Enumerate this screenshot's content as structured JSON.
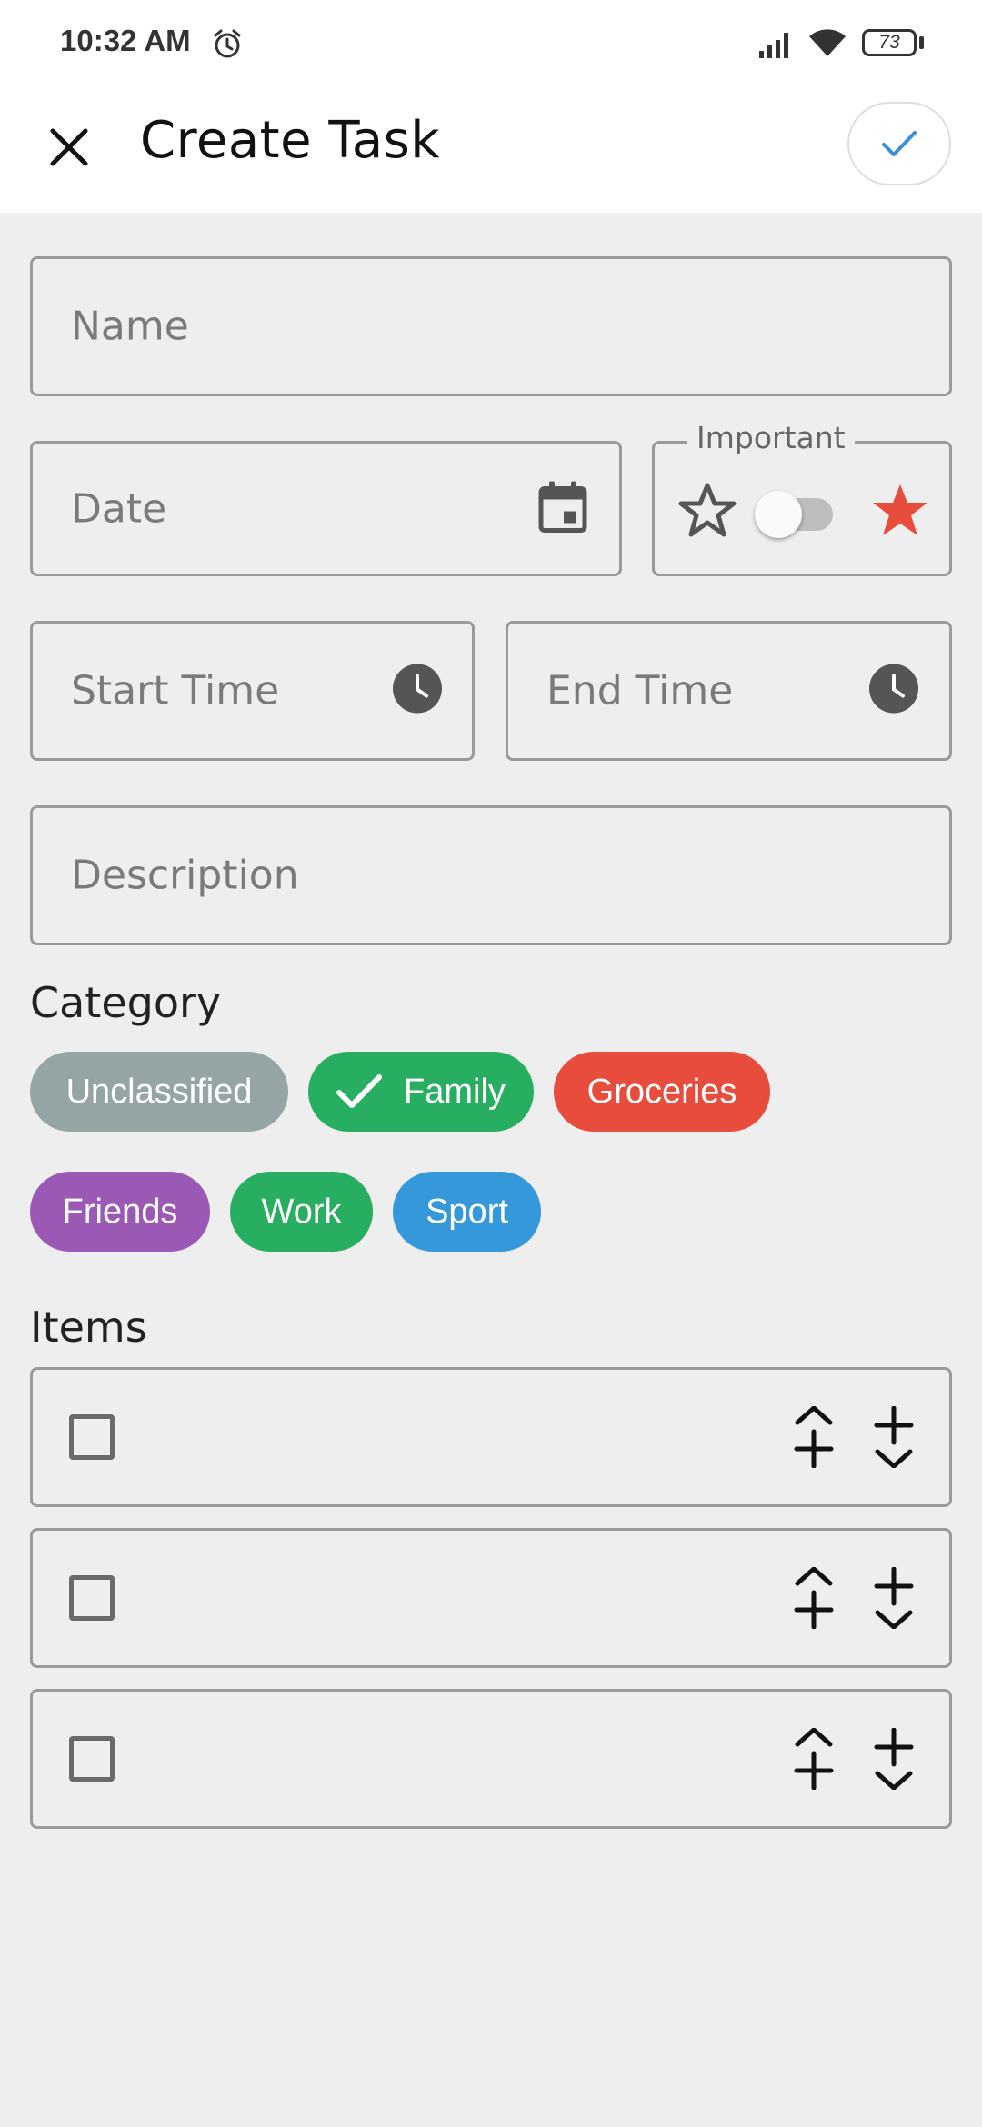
{
  "status_bar": {
    "time": "10:32 AM",
    "battery": "73"
  },
  "app_bar": {
    "title": "Create Task"
  },
  "form": {
    "name_placeholder": "Name",
    "date_placeholder": "Date",
    "important_label": "Important",
    "important_on": false,
    "start_time_placeholder": "Start Time",
    "end_time_placeholder": "End Time",
    "description_placeholder": "Description"
  },
  "category": {
    "label": "Category",
    "chips": [
      {
        "label": "Unclassified",
        "color": "#95a5a6",
        "selected": false
      },
      {
        "label": "Family",
        "color": "#27ae60",
        "selected": true
      },
      {
        "label": "Groceries",
        "color": "#e74c3c",
        "selected": false
      },
      {
        "label": "Friends",
        "color": "#9b59b6",
        "selected": false
      },
      {
        "label": "Work",
        "color": "#27ae60",
        "selected": false
      },
      {
        "label": "Sport",
        "color": "#3498db",
        "selected": false
      }
    ]
  },
  "items": {
    "label": "Items",
    "rows": [
      {
        "checked": false,
        "text": ""
      },
      {
        "checked": false,
        "text": ""
      },
      {
        "checked": false,
        "text": ""
      }
    ]
  },
  "colors": {
    "accent_check": "#3a8fd6",
    "star_filled": "#e74c3c",
    "clock_icon": "#555555"
  }
}
